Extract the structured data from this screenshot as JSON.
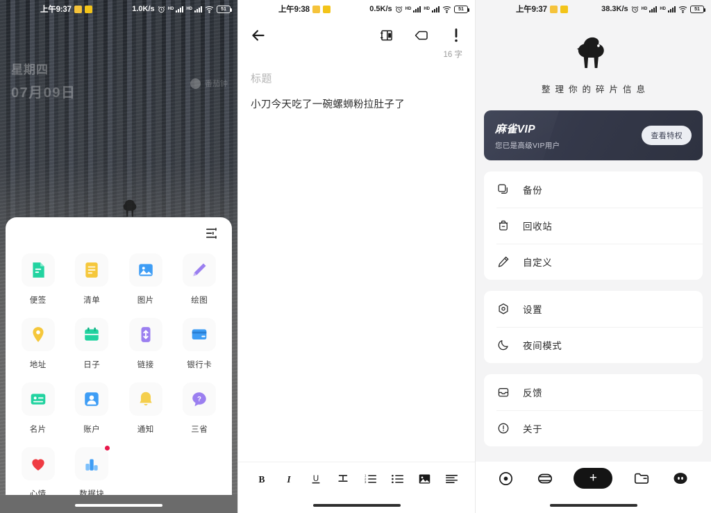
{
  "panel_home": {
    "status_bar": {
      "time": "上午9:37",
      "net_speed": "1.0K/s",
      "battery": "51",
      "icons": [
        "alarm-icon",
        "signal-bars-icon",
        "signal-bars-icon",
        "wifi-icon",
        "battery-icon"
      ]
    },
    "wallpaper": {
      "weekday": "星期四",
      "date": "07月09日",
      "widget_label": "番茄钟"
    },
    "sheet": {
      "filter_icon": "sliders-icon",
      "items": [
        {
          "label": "便签",
          "icon": "note-icon",
          "color": "#22d3a0",
          "badge": false
        },
        {
          "label": "清单",
          "icon": "checklist-icon",
          "color": "#f5c73b",
          "badge": false
        },
        {
          "label": "图片",
          "icon": "image-icon",
          "color": "#3e9df5",
          "badge": false
        },
        {
          "label": "绘图",
          "icon": "pencil-icon",
          "color": "#9b7ff0",
          "badge": false
        },
        {
          "label": "地址",
          "icon": "map-pin-icon",
          "color": "#f5c73b",
          "badge": false
        },
        {
          "label": "日子",
          "icon": "calendar-icon",
          "color": "#22d3a0",
          "badge": false
        },
        {
          "label": "链接",
          "icon": "link-icon",
          "color": "#9b7ff0",
          "badge": false
        },
        {
          "label": "银行卡",
          "icon": "bank-card-icon",
          "color": "#3e9df5",
          "badge": false
        },
        {
          "label": "名片",
          "icon": "business-card-icon",
          "color": "#22d3a0",
          "badge": false
        },
        {
          "label": "账户",
          "icon": "account-icon",
          "color": "#3e9df5",
          "badge": false
        },
        {
          "label": "通知",
          "icon": "bell-icon",
          "color": "#f5cf4d",
          "badge": false
        },
        {
          "label": "三省",
          "icon": "question-bubble-icon",
          "color": "#9b7ff0",
          "badge": false
        },
        {
          "label": "心情",
          "icon": "heart-icon",
          "color": "#ef3b42",
          "badge": false
        },
        {
          "label": "数据块",
          "icon": "bar-chart-icon",
          "color": "#3e9df5",
          "badge": true
        }
      ]
    }
  },
  "panel_editor": {
    "status_bar": {
      "time": "上午9:38",
      "net_speed": "0.5K/s",
      "battery": "51"
    },
    "header": {
      "back_icon": "back-arrow-icon",
      "actions": [
        {
          "name": "book-layout-icon"
        },
        {
          "name": "tag-icon"
        },
        {
          "name": "exclamation-icon"
        }
      ],
      "word_count": "16 字"
    },
    "title_placeholder": "标题",
    "body_text": "小刀今天吃了一碗螺蛳粉拉肚子了",
    "toolbar": [
      {
        "name": "bold-icon",
        "glyph": "B"
      },
      {
        "name": "italic-icon",
        "glyph": "I"
      },
      {
        "name": "underline-icon",
        "glyph": "U"
      },
      {
        "name": "strikethrough-icon",
        "glyph": "S"
      },
      {
        "name": "numbered-list-icon",
        "glyph": "1."
      },
      {
        "name": "bullet-list-icon",
        "glyph": "•"
      },
      {
        "name": "insert-image-icon",
        "glyph": "IMG"
      },
      {
        "name": "align-left-icon",
        "glyph": "≡"
      }
    ]
  },
  "panel_mine": {
    "status_bar": {
      "time": "上午9:37",
      "net_speed": "38.3K/s",
      "battery": "51"
    },
    "logo_icon": "sparrow-bird-logo",
    "tagline": "整理你的碎片信息",
    "vip": {
      "title": "麻雀VIP",
      "subtitle": "您已是高级VIP用户",
      "button_label": "查看特权",
      "card_color": "#343849"
    },
    "menu_groups": [
      {
        "items": [
          {
            "label": "备份",
            "icon": "copy-icon"
          },
          {
            "label": "回收站",
            "icon": "trash-icon"
          },
          {
            "label": "自定义",
            "icon": "pencil-edit-icon"
          }
        ]
      },
      {
        "items": [
          {
            "label": "设置",
            "icon": "gear-icon"
          },
          {
            "label": "夜间模式",
            "icon": "moon-icon"
          }
        ]
      },
      {
        "items": [
          {
            "label": "反馈",
            "icon": "inbox-icon"
          },
          {
            "label": "关于",
            "icon": "info-icon"
          }
        ]
      }
    ],
    "bottom_nav": [
      {
        "name": "target-icon",
        "active": false
      },
      {
        "name": "capsule-icon",
        "active": false
      },
      {
        "name": "add-button",
        "glyph": "+",
        "active": true
      },
      {
        "name": "folder-icon",
        "active": false
      },
      {
        "name": "profile-face-icon",
        "active": true
      }
    ]
  }
}
